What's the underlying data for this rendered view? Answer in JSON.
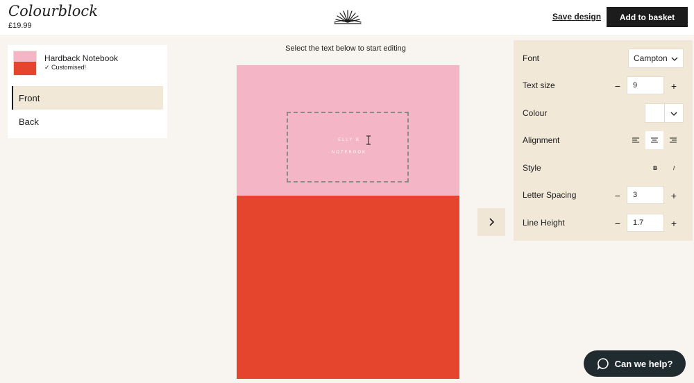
{
  "header": {
    "title": "Colourblock",
    "price": "£19.99",
    "save_label": "Save design",
    "basket_label": "Add to basket"
  },
  "product": {
    "name": "Hardback Notebook",
    "status": "✓ Customised!",
    "tabs": [
      {
        "label": "Front",
        "active": true
      },
      {
        "label": "Back",
        "active": false
      }
    ]
  },
  "canvas": {
    "hint": "Select the text below to start editing",
    "text_lines": [
      "ELLY B",
      "NOTEBOOK"
    ],
    "top_color": "#f4b5c6",
    "bottom_color": "#e5452d"
  },
  "properties": {
    "font_label": "Font",
    "font_value": "Campton",
    "text_size_label": "Text size",
    "text_size_value": "9",
    "colour_label": "Colour",
    "colour_value": "#ffffff",
    "alignment_label": "Alignment",
    "alignment_selected": "center",
    "style_label": "Style",
    "style_bold": "B",
    "style_italic": "I",
    "letter_spacing_label": "Letter Spacing",
    "letter_spacing_value": "3",
    "line_height_label": "Line Height",
    "line_height_value": "1.7"
  },
  "help": {
    "label": "Can we help?"
  },
  "colors": {
    "dark": "#1c1c1c",
    "panel": "#f2e8d8",
    "help_bg": "#1f2b2f"
  }
}
